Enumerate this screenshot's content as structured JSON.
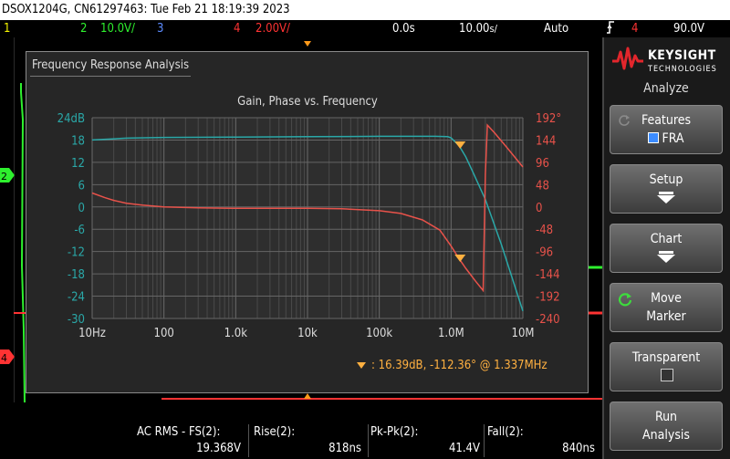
{
  "title": "DSOX1204G, CN61297463: Tue Feb 21 18:19:39 2023",
  "statusbar": {
    "ch1_num": "1",
    "ch2_num": "2",
    "ch2_scale": "10.0V/",
    "ch3_num": "3",
    "ch4_num": "4",
    "ch4_scale": "2.00V/",
    "time_offset": "0.0s",
    "time_scale": "10.00",
    "time_scale_unit": "s/",
    "trigger_mode": "Auto",
    "trigger_icon": "trigger-rising-edge-icon",
    "trigger_channel": "4",
    "trigger_level": "90.0V"
  },
  "colors": {
    "ch1": "#f5f500",
    "ch2": "#2ef02e",
    "ch3": "#5c8cff",
    "ch4": "#ff3333",
    "gain": "#2aa8a8",
    "phase": "#e8524a",
    "marker": "#ffb040",
    "grid": "#555555"
  },
  "dialog": {
    "title": "Frequency Response Analysis",
    "marker_readout": ":  16.39dB, -112.36° @ 1.337MHz"
  },
  "chart_data": {
    "type": "line",
    "title": "Gain, Phase vs. Frequency",
    "x_scale": "log",
    "xlim": [
      10,
      10000000
    ],
    "x_tick_labels": [
      "10Hz",
      "100",
      "1.0k",
      "10k",
      "100k",
      "1.0M",
      "10M"
    ],
    "y_left": {
      "lim": [
        -30,
        24
      ],
      "ticks": [
        "24dB",
        "18",
        "12",
        "6",
        "0",
        "-6",
        "-12",
        "-18",
        "-24",
        "-30"
      ]
    },
    "y_right": {
      "lim": [
        -240,
        192
      ],
      "ticks": [
        "192°",
        "144",
        "96",
        "48",
        "0",
        "-48",
        "-96",
        "-144",
        "-192",
        "-240"
      ]
    },
    "series": [
      {
        "axis": "left",
        "x": [
          10,
          30,
          100,
          1000,
          10000,
          100000,
          300000,
          600000,
          900000,
          1000000,
          1300000,
          1600000,
          2000000,
          3000000,
          5000000,
          10000000
        ],
        "y": [
          18.0,
          18.5,
          18.7,
          18.8,
          18.9,
          19.0,
          19.0,
          19.0,
          18.9,
          18.6,
          16.4,
          13.5,
          9.5,
          2.0,
          -10.0,
          -28.0
        ]
      },
      {
        "axis": "right",
        "x": [
          10,
          15,
          20,
          30,
          50,
          100,
          300,
          1000,
          10000,
          30000,
          100000,
          200000,
          400000,
          700000,
          1000000,
          1300000,
          1600000,
          2200000,
          2800000,
          3000000,
          3200000,
          4000000,
          6000000,
          10000000
        ],
        "y": [
          30,
          20,
          14,
          8,
          4,
          0,
          -2,
          -3,
          -3,
          -4,
          -8,
          -14,
          -28,
          -50,
          -84,
          -112,
          -132,
          -160,
          -180,
          70,
          176,
          160,
          128,
          86
        ]
      }
    ],
    "markers": [
      {
        "x": 1337000,
        "y_left": 16.39
      },
      {
        "x": 1337000,
        "y_right": -112.36
      }
    ]
  },
  "measurements": [
    {
      "name": "AC RMS - FS(2):",
      "value": "19.368V"
    },
    {
      "name": "Rise(2):",
      "value": "818ns"
    },
    {
      "name": "Pk-Pk(2):",
      "value": "41.4V"
    },
    {
      "name": "Fall(2):",
      "value": "840ns"
    }
  ],
  "panel": {
    "brand": "KEYSIGHT",
    "brand_sub": "TECHNOLOGIES",
    "menu_title": "Analyze",
    "features_label": "Features",
    "features_value": "FRA",
    "setup_label": "Setup",
    "chart_label": "Chart",
    "move_label": "Move",
    "marker_label": "Marker",
    "transparent_label": "Transparent",
    "run_label": "Run",
    "analysis_label": "Analysis"
  }
}
